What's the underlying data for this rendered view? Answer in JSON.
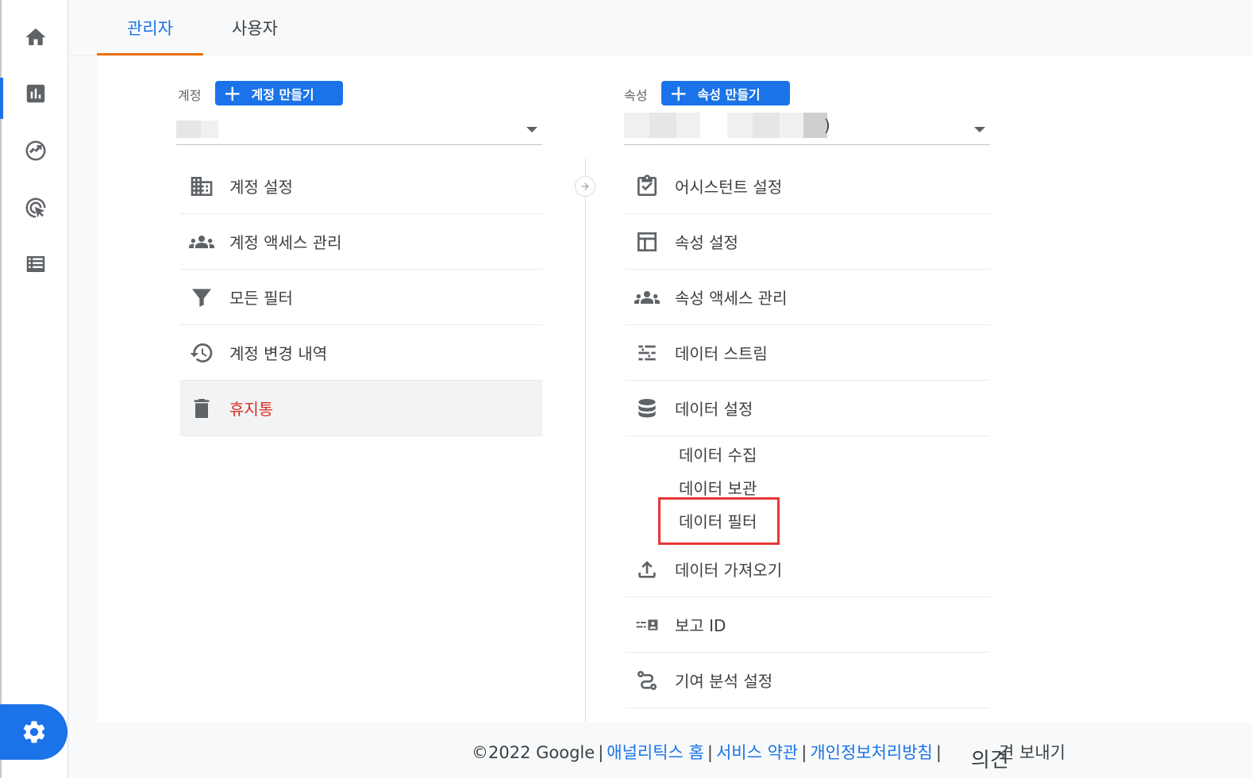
{
  "tabs": [
    {
      "label": "관리자",
      "active": true
    },
    {
      "label": "사용자",
      "active": false
    }
  ],
  "rail": {
    "icons": [
      "home-icon",
      "bar-chart-icon",
      "explore-icon",
      "advertising-icon",
      "list-icon"
    ],
    "settings_icon": "gear-icon"
  },
  "account": {
    "label": "계정",
    "create_button": "계정 만들기",
    "menu": [
      {
        "label": "계정 설정",
        "icon": "building-icon"
      },
      {
        "label": "계정 액세스 관리",
        "icon": "people-icon"
      },
      {
        "label": "모든 필터",
        "icon": "filter-icon"
      },
      {
        "label": "계정 변경 내역",
        "icon": "history-icon"
      },
      {
        "label": "휴지통",
        "icon": "trash-icon"
      }
    ]
  },
  "property": {
    "label": "속성",
    "create_button": "속성 만들기",
    "selector_suffix": ")",
    "menu": [
      {
        "label": "어시스턴트 설정",
        "icon": "checklist-icon"
      },
      {
        "label": "속성 설정",
        "icon": "layout-icon"
      },
      {
        "label": "속성 액세스 관리",
        "icon": "people-icon"
      },
      {
        "label": "데이터 스트림",
        "icon": "streams-icon"
      },
      {
        "label": "데이터 설정",
        "icon": "database-icon"
      }
    ],
    "data_settings_sub": [
      "데이터 수집",
      "데이터 보관",
      "데이터 필터"
    ],
    "menu_after": [
      {
        "label": "데이터 가져오기",
        "icon": "upload-icon"
      },
      {
        "label": "보고 ID",
        "icon": "reporting-id-icon"
      },
      {
        "label": "기여 분석 설정",
        "icon": "attribution-icon"
      }
    ]
  },
  "highlight_color": "#e53935",
  "footer": {
    "copyright": "©2022 Google",
    "links": [
      "애널리틱스 홈",
      "서비스 약관",
      "개인정보처리방침"
    ],
    "feedback_overlay": "의견",
    "feedback": "견 보내기"
  }
}
